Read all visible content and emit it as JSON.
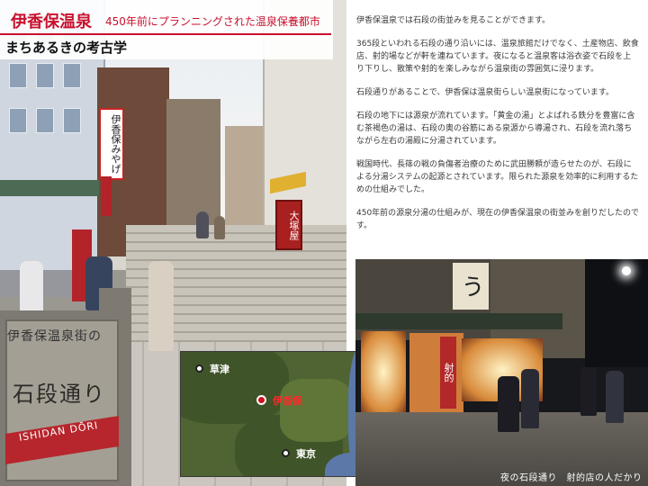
{
  "header": {
    "title": "伊香保温泉",
    "subtitle": "450年前にプランニングされた温泉保養都市",
    "section_heading": "まちあるきの考古学"
  },
  "photo_left": {
    "shop_sign_1": "伊香保みやげ",
    "shop_sign_2": "大塚屋",
    "monument_small": "伊香保温泉街の",
    "monument_large": "石段通り",
    "monument_romaji": "ISHIDAN DŌRI"
  },
  "map": {
    "places": [
      {
        "name": "草津",
        "highlight": false
      },
      {
        "name": "伊香保",
        "highlight": true
      },
      {
        "name": "東京",
        "highlight": false
      }
    ],
    "colors": {
      "land": "#4f6333",
      "sea": "#5b78a8",
      "highlight": "#d1121b"
    }
  },
  "article": {
    "paragraphs": [
      "伊香保温泉では石段の街並みを見ることができます。",
      "365段といわれる石段の通り沿いには、温泉旅館だけでなく、土産物店、飲食店、射的場などが軒を連ねています。夜になると温泉客は浴衣姿で石段を上り下りし、散策や射的を楽しみながら温泉街の雰囲気に浸ります。",
      "石段通りがあることで、伊香保は温泉街らしい温泉街になっています。",
      "石段の地下には源泉が流れています。「黄金の湯」とよばれる鉄分を豊富に含む茶褐色の湯は、石段の奥の谷筋にある泉源から導湯され、石段を流れ落ちながら左右の湯殿に分湯されています。",
      "戦国時代、長篠の戦の負傷者治療のために武田勝頼が造らせたのが、石段による分湯システムの起源とされています。限られた源泉を効率的に利用するための仕組みでした。",
      "450年前の源泉分湯の仕組みが、現在の伊香保温泉の街並みを創りだしたのです。"
    ]
  },
  "photo_night": {
    "sign_1": "う",
    "sign_2": "射的",
    "caption": "夜の石段通り　射的店の人だかり"
  },
  "colors": {
    "accent": "#c8102e",
    "text": "#3a3a3a"
  }
}
